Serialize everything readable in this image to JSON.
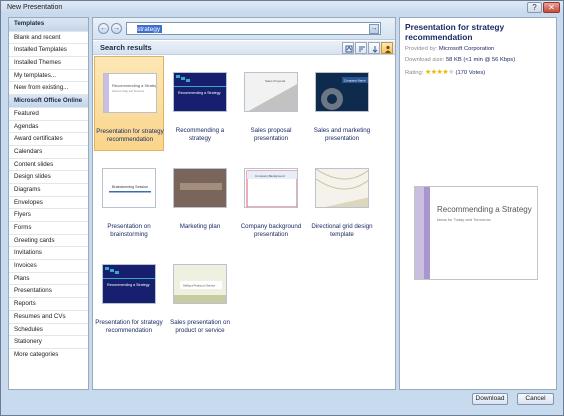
{
  "window": {
    "title": "New Presentation",
    "help_glyph": "?",
    "close_glyph": "✕"
  },
  "sidebar": {
    "items": [
      {
        "label": "Templates",
        "type": "header"
      },
      {
        "label": "Blank and recent",
        "type": "item"
      },
      {
        "label": "Installed Templates",
        "type": "item"
      },
      {
        "label": "Installed Themes",
        "type": "item"
      },
      {
        "label": "My templates...",
        "type": "item"
      },
      {
        "label": "New from existing...",
        "type": "item"
      },
      {
        "label": "Microsoft Office Online",
        "type": "header"
      },
      {
        "label": "Featured",
        "type": "item"
      },
      {
        "label": "Agendas",
        "type": "item"
      },
      {
        "label": "Award certificates",
        "type": "item"
      },
      {
        "label": "Calendars",
        "type": "item"
      },
      {
        "label": "Content slides",
        "type": "item"
      },
      {
        "label": "Design slides",
        "type": "item"
      },
      {
        "label": "Diagrams",
        "type": "item"
      },
      {
        "label": "Envelopes",
        "type": "item"
      },
      {
        "label": "Flyers",
        "type": "item"
      },
      {
        "label": "Forms",
        "type": "item"
      },
      {
        "label": "Greeting cards",
        "type": "item"
      },
      {
        "label": "Invitations",
        "type": "item"
      },
      {
        "label": "Invoices",
        "type": "item"
      },
      {
        "label": "Plans",
        "type": "item"
      },
      {
        "label": "Presentations",
        "type": "item"
      },
      {
        "label": "Reports",
        "type": "item"
      },
      {
        "label": "Resumes and CVs",
        "type": "item"
      },
      {
        "label": "Schedules",
        "type": "item"
      },
      {
        "label": "Stationery",
        "type": "item"
      },
      {
        "label": "More categories",
        "type": "item"
      }
    ]
  },
  "search": {
    "value": "strategy",
    "back_glyph": "←",
    "forward_glyph": "→",
    "go_glyph": "→"
  },
  "results": {
    "title": "Search results",
    "view_buttons": [
      "sort-by-rating-icon",
      "sort-by-name-icon",
      "sort-descending-icon",
      "user-icon"
    ],
    "items": [
      {
        "label": "Presentation for strategy recommendation",
        "selected": true,
        "thumb_title": "Recommending a Strategy"
      },
      {
        "label": "Recommending a strategy",
        "selected": false,
        "thumb_title": "Recommending a Strategy"
      },
      {
        "label": "Sales proposal presentation",
        "selected": false,
        "thumb_title": "Sales Proposal"
      },
      {
        "label": "Sales and marketing presentation",
        "selected": false,
        "thumb_title": "Company Name"
      },
      {
        "label": "Presentation on brainstorming",
        "selected": false,
        "thumb_title": "Brainstorming Session"
      },
      {
        "label": "Marketing plan",
        "selected": false,
        "thumb_title": ""
      },
      {
        "label": "Company background presentation",
        "selected": false,
        "thumb_title": "Company Background"
      },
      {
        "label": "Directional grid design template",
        "selected": false,
        "thumb_title": ""
      },
      {
        "label": "Presentation for strategy recommendation",
        "selected": false,
        "thumb_title": "Recommending a Strategy"
      },
      {
        "label": "Sales presentation on product or service",
        "selected": false,
        "thumb_title": "Selling a Product or Service"
      }
    ]
  },
  "preview": {
    "title": "Presentation for strategy recommendation",
    "provided_by_label": "Provided by:",
    "provided_by_value": "Microsoft Corporation",
    "download_size_label": "Download size:",
    "download_size_value": "58 KB (<1 min @ 56 Kbps)",
    "rating_label": "Rating:",
    "rating_value": 4,
    "votes": "(170 Votes)",
    "slide_title": "Recommending a Strategy",
    "slide_subtitle": "Ideas for Today and Tomorrow"
  },
  "footer": {
    "download_label": "Download",
    "cancel_label": "Cancel"
  },
  "colors": {
    "selection": "#fad58a",
    "link": "#1b2a66",
    "navy": "#1a2a78",
    "accent": "#f0b400"
  }
}
